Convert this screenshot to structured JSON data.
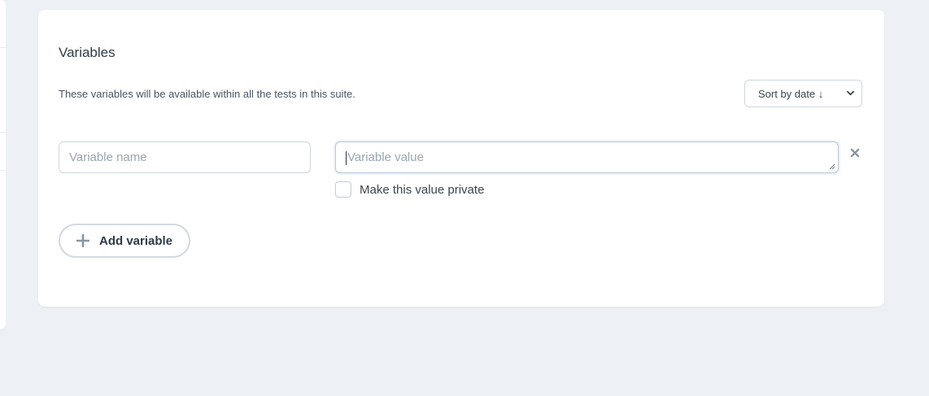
{
  "section": {
    "title": "Variables",
    "description": "These variables will be available within all the tests in this suite."
  },
  "sort": {
    "selected": "Sort by date ↓"
  },
  "variable_row": {
    "name_placeholder": "Variable name",
    "value_placeholder": "Variable value",
    "private_label": "Make this value private",
    "private_checked": false
  },
  "actions": {
    "add_variable_label": "Add variable"
  },
  "icons": {
    "remove": "close-icon",
    "add": "plus-icon",
    "dropdown": "chevron-down-icon"
  },
  "colors": {
    "background": "#edf1f5",
    "card": "#ffffff",
    "border": "#cfd6df",
    "muted_text": "#9aa5b1",
    "icon": "#8a96a3"
  }
}
